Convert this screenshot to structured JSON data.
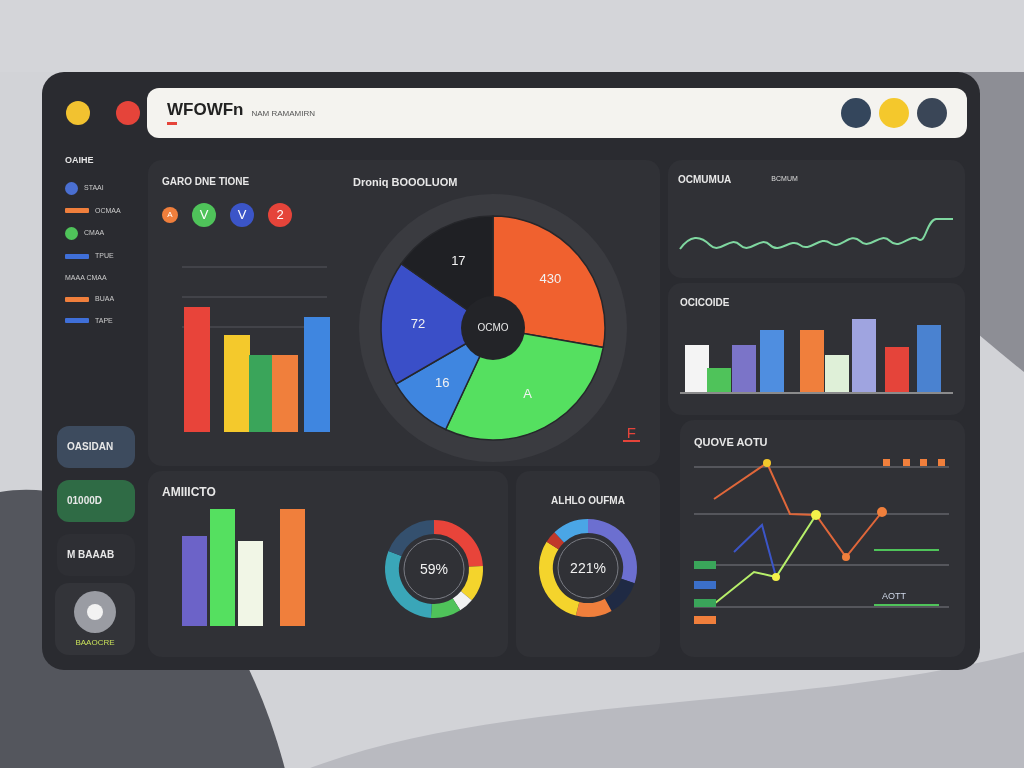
{
  "window": {
    "controls": [
      {
        "color": "#f2c230"
      },
      {
        "color": "#e5443a"
      }
    ]
  },
  "header": {
    "title": "WFOWFn",
    "subtitle": "NAM RAMAMIRN",
    "buttons": [
      {
        "color": "#34465c"
      },
      {
        "color": "#f4c82c"
      },
      {
        "color": "#3a4657"
      }
    ]
  },
  "sidebar": {
    "heading": "OAIHE",
    "items": [
      {
        "kind": "dot",
        "label": "STAAI",
        "color": "#4a6fd1"
      },
      {
        "kind": "bar",
        "label": "OCMAA",
        "color": "#f07f3c"
      },
      {
        "kind": "dot",
        "label": "CMAA",
        "color": "#4fc35a"
      },
      {
        "kind": "bar",
        "label": "TPUE",
        "color": "#3f6fd8"
      },
      {
        "kind": "text",
        "label": "MAAA CMAA"
      },
      {
        "kind": "bar",
        "label": "BUAA",
        "color": "#f07f3c"
      },
      {
        "kind": "bar",
        "label": "TAPE",
        "color": "#3f6fd8"
      }
    ],
    "cards": [
      {
        "label": "OASIDAN",
        "color": "#3d4b5e"
      },
      {
        "label": "01000D",
        "color": "#2f6b45"
      },
      {
        "label": "M BAAAB",
        "color": "#2e2f34"
      }
    ],
    "profile_label": "BAAOCRE"
  },
  "status_panel": {
    "title": "GARO DNE TIONE",
    "badges": [
      {
        "label": "A",
        "color": "#f07f3c"
      },
      {
        "label": "V",
        "color": "#4fc35a"
      },
      {
        "label": "V",
        "color": "#3b55c8"
      },
      {
        "label": "2",
        "color": "#e5443a"
      }
    ]
  },
  "pie_panel": {
    "title": "Droniq BOOOLUOM",
    "slices": [
      {
        "label": "430",
        "color": "#f0612f"
      },
      {
        "label": "A",
        "color": "#55e060"
      },
      {
        "label": "16",
        "color": "#3f86e0"
      },
      {
        "label": "72",
        "color": "#3a4fc8"
      },
      {
        "label": "17",
        "color": "#1f2024"
      }
    ],
    "center_label": "OCMO",
    "marker": "F"
  },
  "wave_panel": {
    "title": "OCMUMUA",
    "subtitle": "BCMUM"
  },
  "bars_panel": {
    "title": "OCICOIDE"
  },
  "line_panel": {
    "title": "QUOVE AOTU",
    "note": "AOTT"
  },
  "mix_panel": {
    "title": "AMIIICTO",
    "donut_label": "59%"
  },
  "gauge_panel": {
    "title": "ALHLO OUFMA",
    "donut_label": "221%"
  }
}
